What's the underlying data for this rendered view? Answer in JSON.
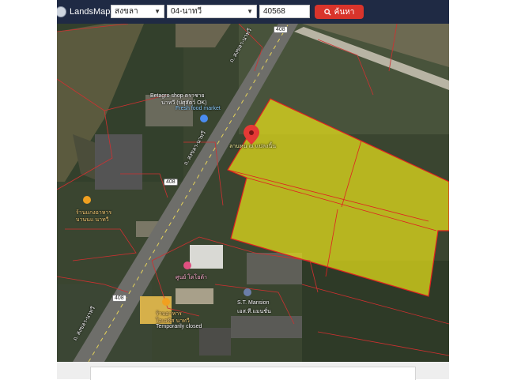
{
  "app": {
    "title": "LandsMaps"
  },
  "toolbar": {
    "province": "สงขลา",
    "district": "04-นาทวี",
    "parcel_number": "40568",
    "search_label": "ค้นหา"
  },
  "map": {
    "road_shield_top": "408",
    "road_shield_mid": "408",
    "road_shield_bottom": "408",
    "road_name_1": "ถ. สงขลา-นาทวี",
    "road_name_2": "ถ. สงขลา-นาทวี",
    "road_name_3": "ถ. สงขลา-นาทวี",
    "poi_betagro_1": "Betagro shop ตราชาย",
    "poi_betagro_2": "นาทวี (ปศุสัตว์ OK)",
    "poi_betagro_3": "Fresh food market",
    "poi_parcel_1": "ลานหน ณ แปลงนี้น",
    "poi_food_1": "ร้านแกงอาหาร",
    "poi_food_2": "บานนแ นาทวี",
    "poi_center": "ศูนย์ โตโยต้า",
    "poi_mansion_1": "S.T. Mansion",
    "poi_mansion_2": "เอส.ที.แมนชั่น",
    "poi_rest_1": "ร้านอาหาร",
    "poi_rest_2": "โอเอซีส นาทวี",
    "poi_rest_3": "Temporarily closed"
  },
  "colors": {
    "header": "#1f2a44",
    "search_button": "#d9342b",
    "parcel_fill": "#e8e01a",
    "parcel_line": "#e02020"
  }
}
